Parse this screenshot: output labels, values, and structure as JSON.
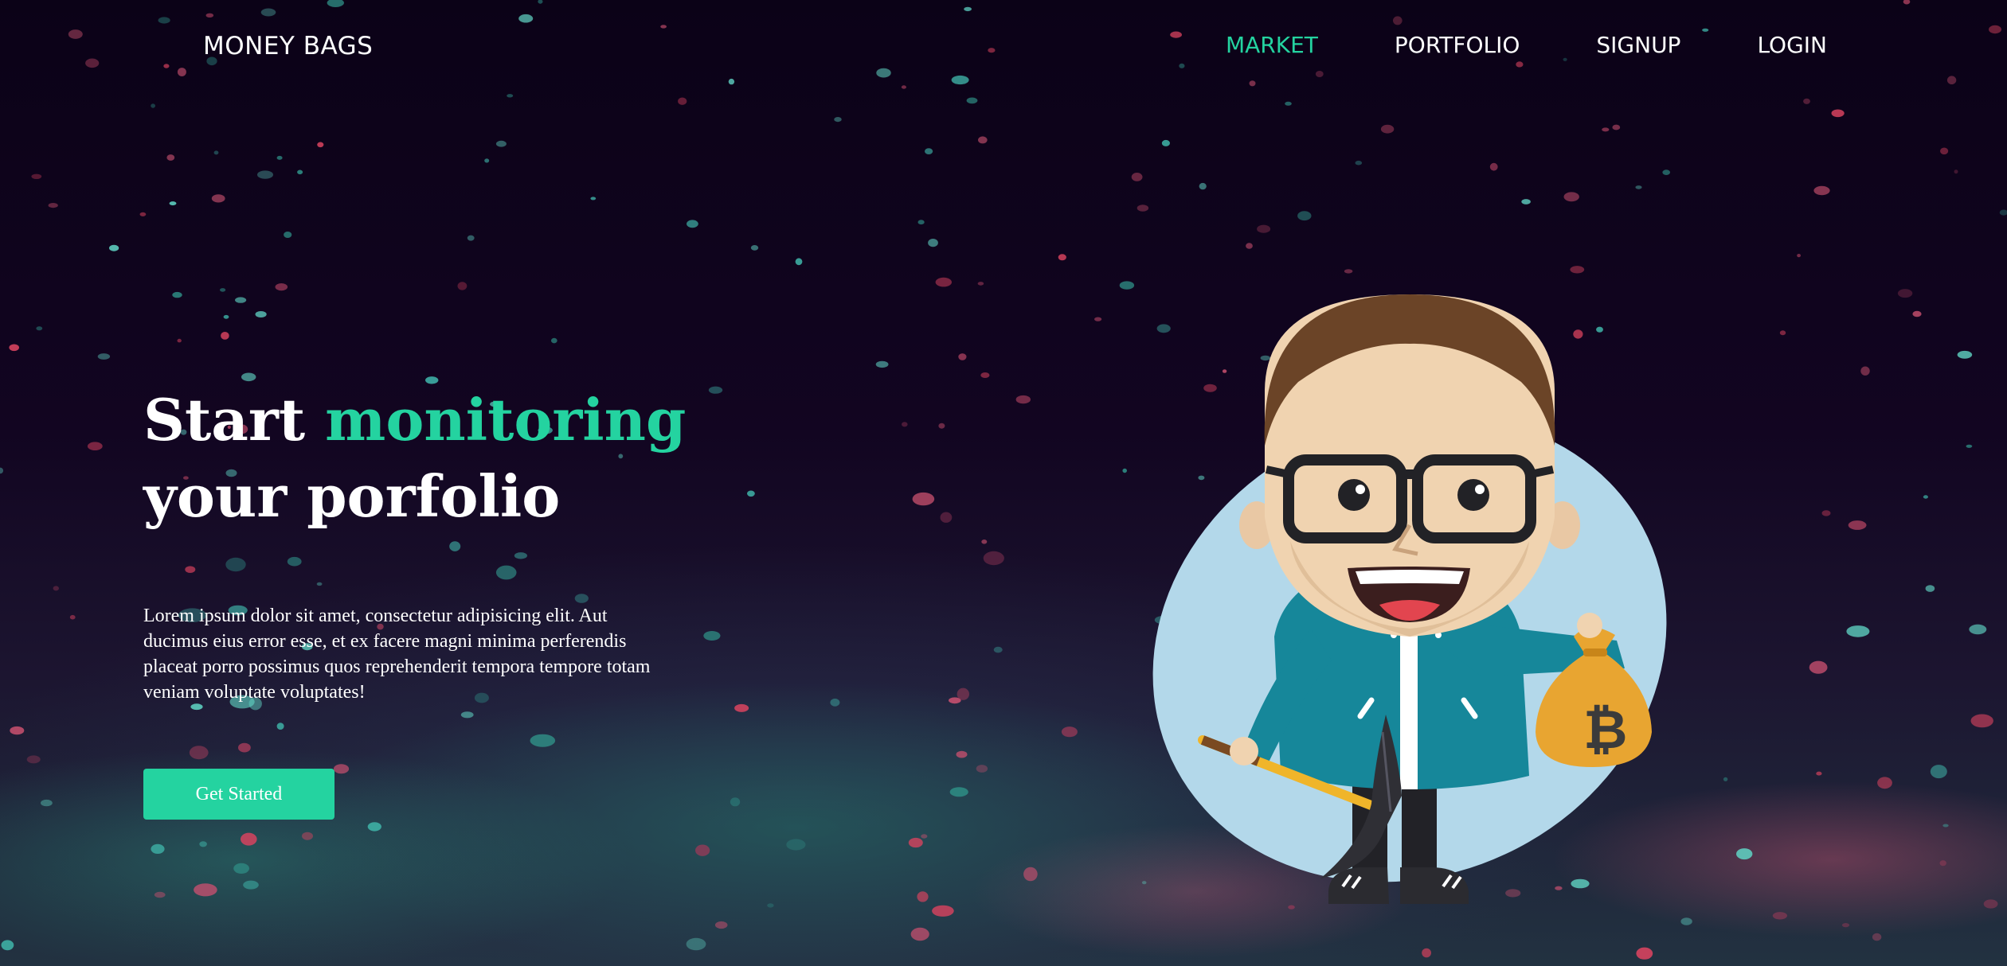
{
  "header": {
    "brand": "MONEY BAGS",
    "nav": [
      {
        "label": "MARKET",
        "active": true
      },
      {
        "label": "PORTFOLIO",
        "active": false
      },
      {
        "label": "SIGNUP",
        "active": false
      },
      {
        "label": "LOGIN",
        "active": false
      }
    ]
  },
  "hero": {
    "title_part1": "Start ",
    "title_accent": "monitoring",
    "title_line2": "your porfolio",
    "body": "Lorem ipsum dolor sit amet, consectetur adipisicing elit. Aut ducimus eius error esse, et ex facere magni minima perferendis placeat porro possimus quos reprehenderit tempora tempore totam veniam voluptate voluptates!",
    "cta_label": "Get Started"
  },
  "illustration": {
    "subject": "cartoon-man-with-pickaxe-and-bitcoin-bag",
    "icons": [
      "bitcoin-icon",
      "pickaxe-icon",
      "money-bag-icon"
    ]
  },
  "colors": {
    "accent": "#24d3a0",
    "background": "#0c0318",
    "text": "#ffffff",
    "bag": "#e8a531",
    "jacket": "#16879a",
    "blob": "#b3d8ea"
  }
}
